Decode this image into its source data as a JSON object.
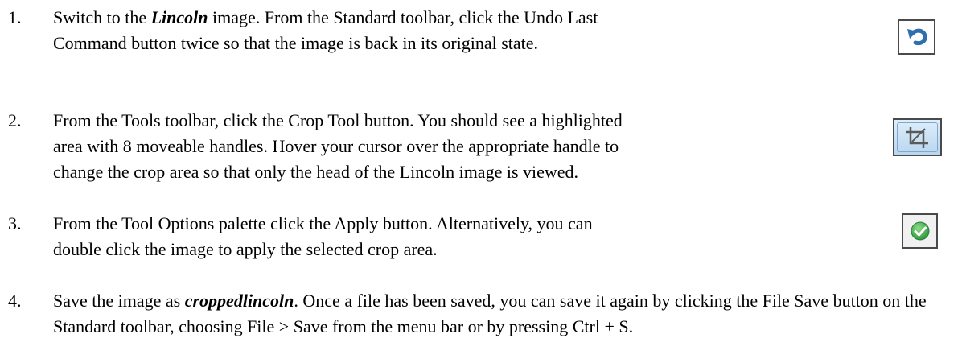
{
  "steps": [
    {
      "number": "1.",
      "parts": [
        "Switch to the ",
        "Lincoln",
        " image. From the Standard toolbar, click the Undo Last Command button twice so that the image is back in its original state."
      ],
      "icon": "undo-arrow-icon"
    },
    {
      "number": "2.",
      "text": "From the Tools toolbar, click the Crop Tool button. You should see a highlighted area with 8 moveable handles. Hover your cursor over the appropriate handle to change the crop area so that only the head of the Lincoln image is viewed.",
      "icon": "crop-tool-icon"
    },
    {
      "number": "3.",
      "text": "From the Tool Options palette click the Apply button. Alternatively, you can double click the image to apply the selected crop area.",
      "icon": "apply-checkmark-icon"
    },
    {
      "number": "4.",
      "parts": [
        "Save the image as ",
        "croppedlincoln",
        ". Once a file has been saved, you can save it again by clicking the File Save button on the Standard toolbar, choosing File > Save from the menu bar or by pressing Ctrl + S."
      ]
    }
  ],
  "colors": {
    "text": "#000000",
    "undo_arrow": "#2f6fb0",
    "crop_button_bg": "#c9e0f4",
    "apply_check_green": "#3aa34a"
  }
}
